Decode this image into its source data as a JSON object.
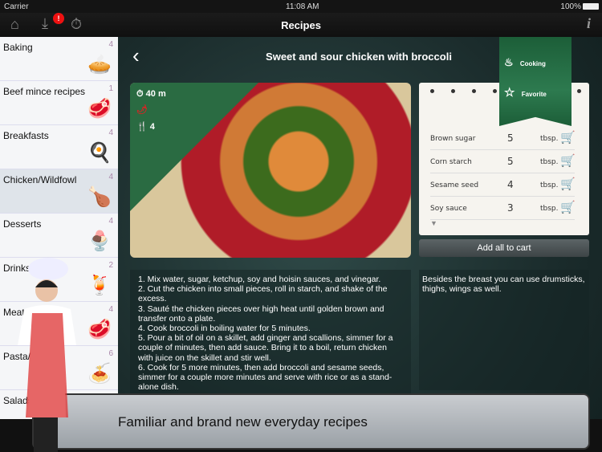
{
  "status": {
    "carrier": "Carrier",
    "time": "11:08 AM",
    "battery": "100%"
  },
  "nav": {
    "title": "Recipes",
    "badge": "!",
    "icons": [
      "home-icon",
      "download-icon",
      "stopwatch-icon",
      "info-icon"
    ]
  },
  "categories": [
    {
      "name": "Baking",
      "count": "4",
      "icon": "🥧"
    },
    {
      "name": "Beef mince recipes",
      "count": "1",
      "icon": "🥩"
    },
    {
      "name": "Breakfasts",
      "count": "4",
      "icon": "🍳"
    },
    {
      "name": "Chicken/Wildfowl",
      "count": "4",
      "icon": "🍗",
      "selected": true
    },
    {
      "name": "Desserts",
      "count": "4",
      "icon": "🍨"
    },
    {
      "name": "Drinks",
      "count": "2",
      "icon": "🍹"
    },
    {
      "name": "Meat",
      "count": "4",
      "icon": "🥩"
    },
    {
      "name": "Pasta/Grains",
      "count": "6",
      "icon": "🍝"
    },
    {
      "name": "Salads",
      "count": "",
      "icon": ""
    }
  ],
  "recipe": {
    "title": "Sweet and sour chicken with broccoli",
    "time": "40 m",
    "servings": "4",
    "ribbon": {
      "cooking": "Cooking",
      "favorite": "Favorite"
    },
    "ingredients": [
      {
        "name": "Brown sugar",
        "qty": "5",
        "unit": "tbsp."
      },
      {
        "name": "Corn starch",
        "qty": "5",
        "unit": "tbsp."
      },
      {
        "name": "Sesame seed",
        "qty": "4",
        "unit": "tbsp."
      },
      {
        "name": "Soy sauce",
        "qty": "3",
        "unit": "tbsp."
      }
    ],
    "add_all": "Add all to cart",
    "steps": [
      "1. Mix water, sugar, ketchup, soy and hoisin sauces, and vinegar.",
      "2. Cut the chicken into small pieces, roll in starch, and shake of the excess.",
      "3. Sauté the chicken pieces over high heat until golden brown and transfer onto a plate.",
      "4. Cook broccoli in boiling water for 5 minutes.",
      "5. Pour a bit of oil on a skillet, add ginger and scallions, simmer for a couple of minutes, then add sauce. Bring it to a boil, return chicken with juice on the skillet and stir well.",
      "6. Cook for 5 more minutes, then add broccoli and sesame seeds, simmer for a couple more minutes and serve with rice or as a stand-alone dish."
    ],
    "note": "Besides the breast you can use drumsticks, thighs, wings as well."
  },
  "banner": "Familiar and brand new everyday recipes"
}
